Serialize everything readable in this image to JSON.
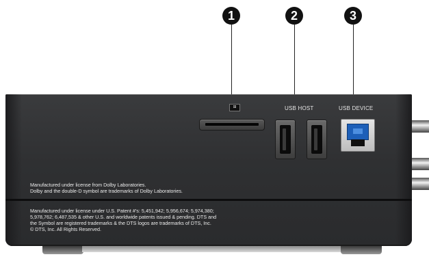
{
  "callouts": [
    "1",
    "2",
    "3"
  ],
  "ports": {
    "card_icon": "⊞",
    "usb_host_label": "USB HOST",
    "usb_device_label": "USB DEVICE"
  },
  "legal": {
    "dolby": [
      "Manufactured under license from Dolby Laboratories.",
      "Dolby and the double-D symbol are trademarks of Dolby Laboratories."
    ],
    "dts": [
      "Manufactured under license under U.S. Patent #’s: 5,451,942; 5,956,674; 5,974,380;",
      "5,978,762; 6,487,535 & other U.S. and worldwide patents issued & pending. DTS and",
      "the Symbol are registered trademarks & the DTS logos are trademarks of DTS, Inc.",
      "© DTS, Inc. All Rights Reserved."
    ]
  }
}
